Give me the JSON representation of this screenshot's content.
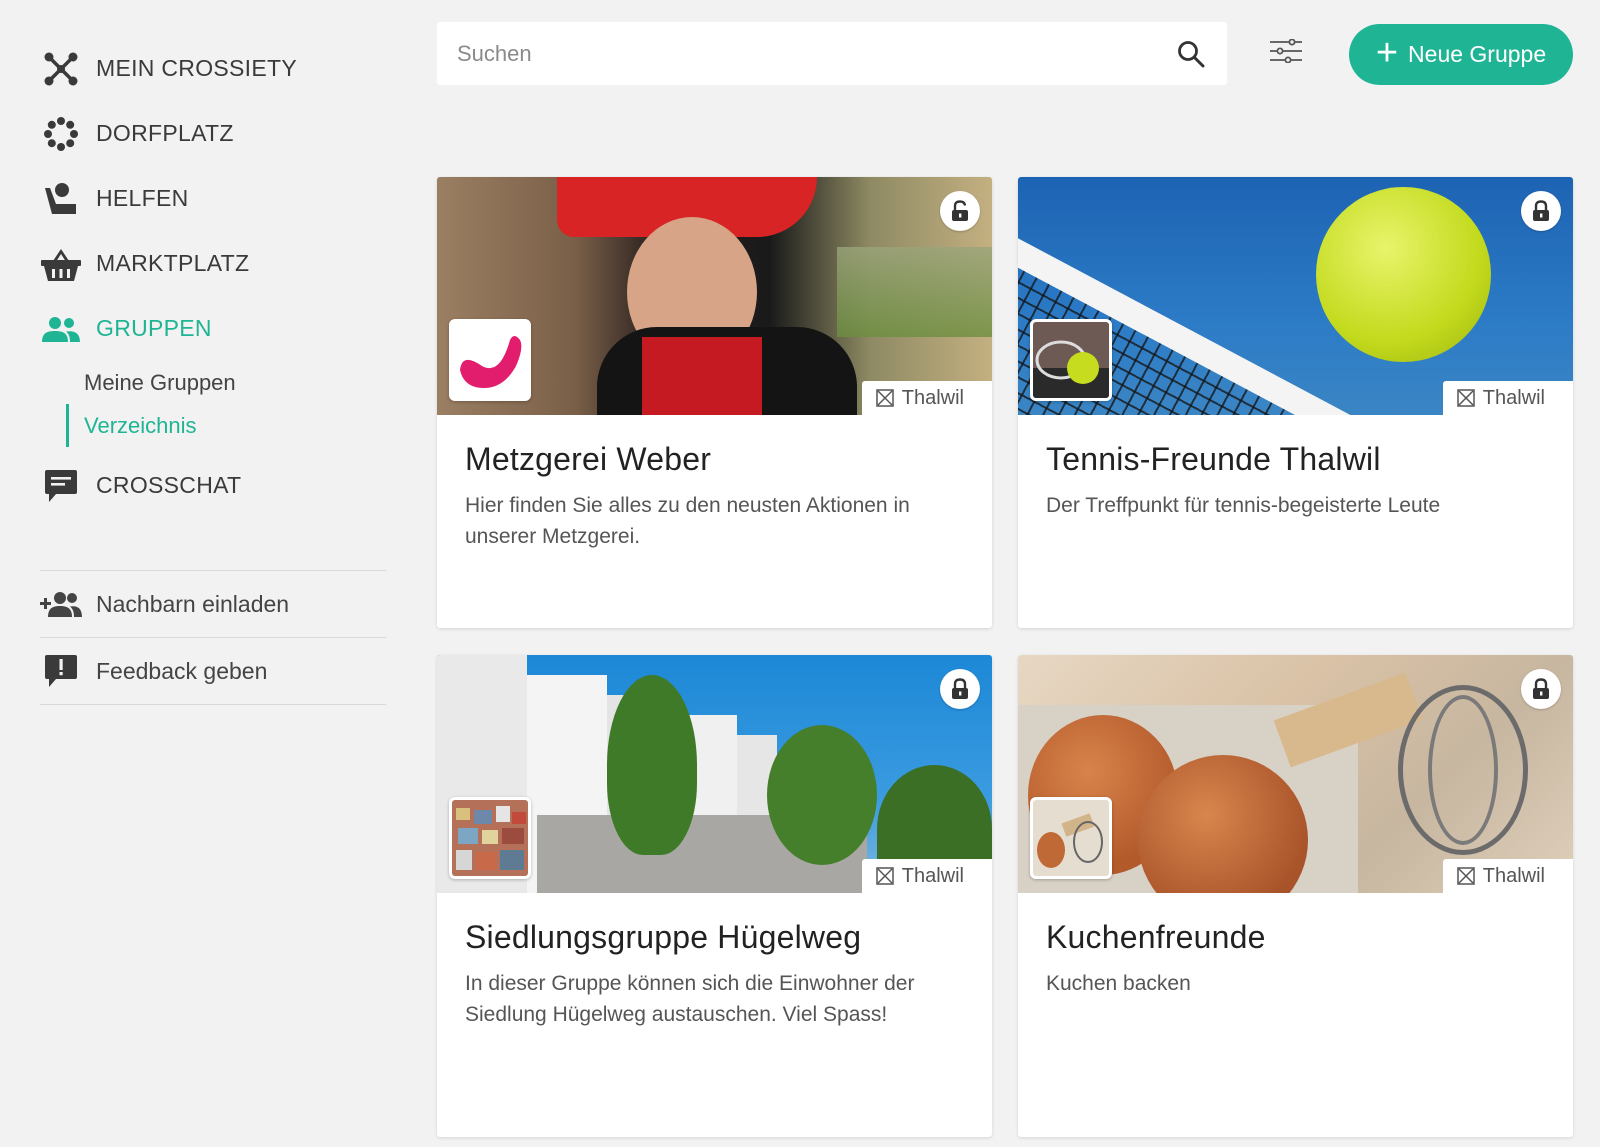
{
  "sidebar": {
    "nav": [
      {
        "label": "MEIN CROSSIETY",
        "icon": "crossiety-icon"
      },
      {
        "label": "DORFPLATZ",
        "icon": "dorfplatz-icon"
      },
      {
        "label": "HELFEN",
        "icon": "helfen-icon"
      },
      {
        "label": "MARKTPLATZ",
        "icon": "basket-icon"
      },
      {
        "label": "GRUPPEN",
        "icon": "group-icon"
      },
      {
        "label": "CROSSCHAT",
        "icon": "chat-icon"
      }
    ],
    "sub": [
      {
        "label": "Meine Gruppen"
      },
      {
        "label": "Verzeichnis"
      }
    ],
    "actions": [
      {
        "label": "Nachbarn einladen",
        "icon": "add-group-icon"
      },
      {
        "label": "Feedback geben",
        "icon": "feedback-icon"
      }
    ]
  },
  "search": {
    "placeholder": "Suchen"
  },
  "new_group": {
    "label": "Neue Gruppe"
  },
  "colors": {
    "accent": "#1fb594"
  },
  "cards": [
    {
      "title": "Metzgerei Weber",
      "description": "Hier finden Sie alles zu den neusten Aktionen in unserer Metzgerei.",
      "location": "Thalwil",
      "lock": "unlocked-icon"
    },
    {
      "title": "Tennis-Freunde Thalwil",
      "description": "Der Treffpunkt für tennis-begeisterte Leute",
      "location": "Thalwil",
      "lock": "locked-icon"
    },
    {
      "title": "Siedlungsgruppe Hügelweg",
      "description": "In dieser Gruppe können sich die Einwohner der Siedlung Hügelweg austauschen. Viel Spass!",
      "location": "Thalwil",
      "lock": "locked-icon"
    },
    {
      "title": "Kuchenfreunde",
      "description": "Kuchen backen",
      "location": "Thalwil",
      "lock": "locked-icon"
    }
  ]
}
